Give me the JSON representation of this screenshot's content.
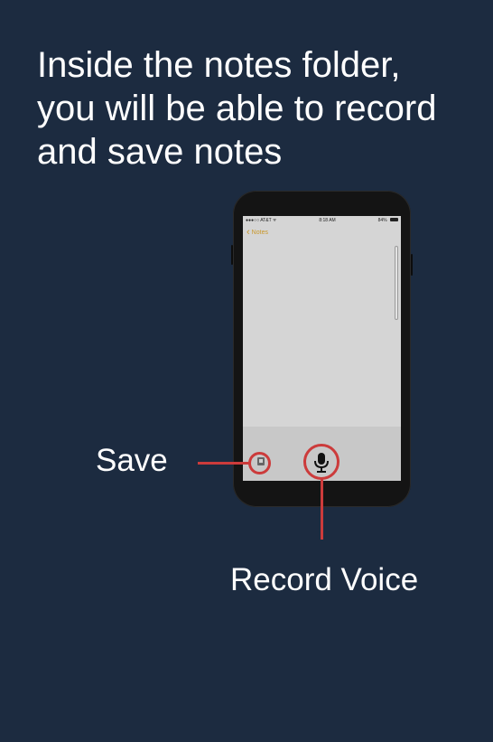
{
  "headline": {
    "line1": "Inside the notes folder,",
    "line2": "you will be able to record",
    "line3": "and save notes"
  },
  "phone": {
    "status_carrier": "●●●○○ AT&T ᯤ",
    "status_time": "8:18 AM",
    "status_battery": "84%",
    "back_label": "Notes",
    "accent_color": "#c9972a"
  },
  "annotations": {
    "save_label": "Save",
    "record_label": "Record Voice",
    "highlight_color": "#cc3b3b"
  },
  "icons": {
    "back": "chevron-left-icon",
    "save": "save-icon",
    "record": "microphone-icon"
  }
}
